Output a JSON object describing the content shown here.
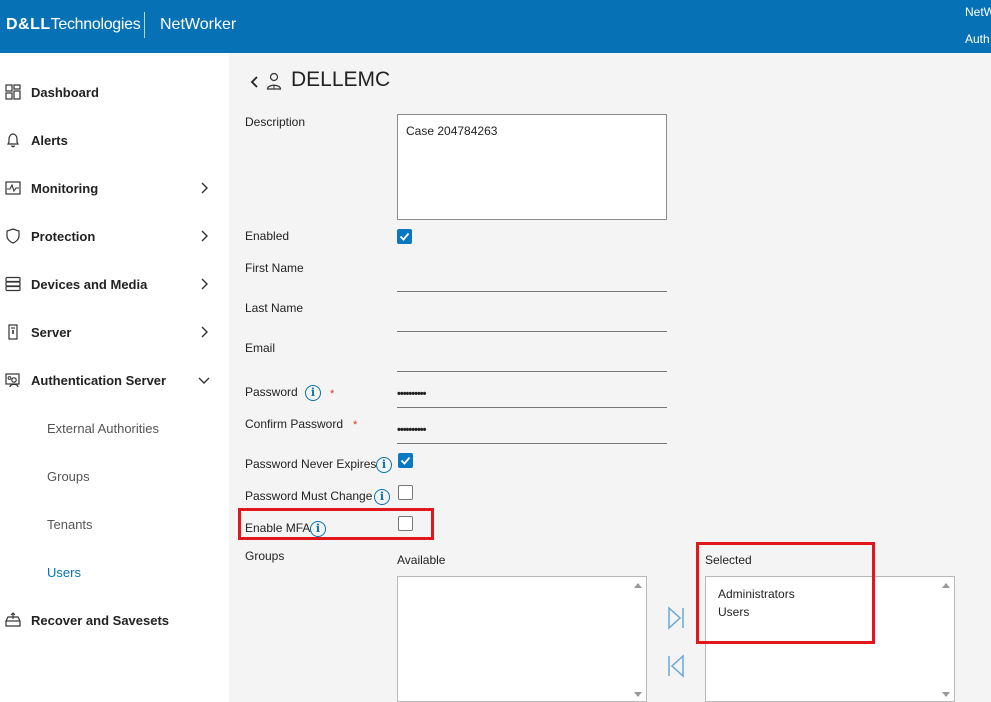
{
  "header": {
    "brand_bold": "D&LL",
    "brand_light": "Technologies",
    "app_name": "NetWorker",
    "right_line1": "NetW",
    "right_line2": "Auth"
  },
  "sidebar": {
    "items": [
      {
        "label": "Dashboard",
        "icon": "dashboard-icon"
      },
      {
        "label": "Alerts",
        "icon": "bell-icon"
      },
      {
        "label": "Monitoring",
        "icon": "monitor-icon"
      },
      {
        "label": "Protection",
        "icon": "shield-icon"
      },
      {
        "label": "Devices and Media",
        "icon": "storage-icon"
      },
      {
        "label": "Server",
        "icon": "server-icon"
      },
      {
        "label": "Authentication Server",
        "icon": "auth-server-icon"
      },
      {
        "label": "Recover and Savesets",
        "icon": "recover-icon"
      }
    ],
    "sub_items": [
      "External Authorities",
      "Groups",
      "Tenants",
      "Users"
    ],
    "active_sub_item": "Users"
  },
  "page": {
    "title": "DELLEMC"
  },
  "form": {
    "description_label": "Description",
    "description_value": "Case 204784263",
    "enabled_label": "Enabled",
    "enabled_checked": true,
    "first_name_label": "First Name",
    "first_name_value": "",
    "last_name_label": "Last Name",
    "last_name_value": "",
    "email_label": "Email",
    "email_value": "",
    "password_label": "Password",
    "password_required": "*",
    "password_value": "••••••••••",
    "confirm_password_label": "Confirm Password",
    "confirm_password_required": "*",
    "confirm_password_value": "••••••••••",
    "never_expires_label": "Password Never Expires",
    "never_expires_checked": true,
    "must_change_label": "Password Must Change",
    "must_change_checked": false,
    "enable_mfa_label": "Enable MFA",
    "enable_mfa_checked": false,
    "groups_label": "Groups",
    "available_label": "Available",
    "available_items": [],
    "selected_label": "Selected",
    "selected_items": [
      "Administrators",
      "Users"
    ]
  },
  "colors": {
    "header_bg": "#0672b5",
    "accent": "#0a77c1",
    "highlight_red": "#e1171c"
  }
}
